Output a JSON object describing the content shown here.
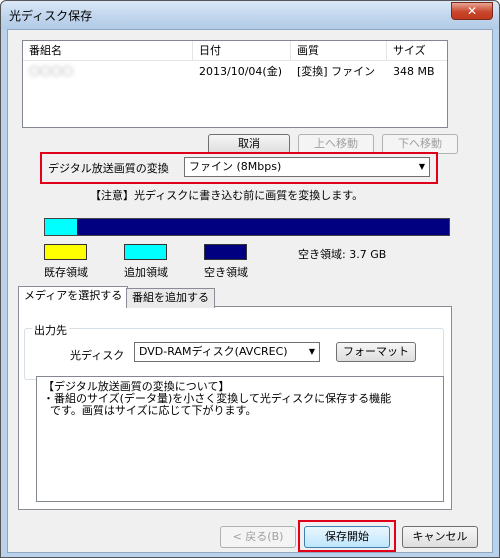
{
  "window": {
    "title": "光ディスク保存",
    "close_glyph": "✕"
  },
  "list": {
    "columns": [
      "番組名",
      "日付",
      "画質",
      "サイズ"
    ],
    "rows": [
      {
        "name": "〇〇〇〇",
        "date": "2013/10/04(金)",
        "quality": "[変換] ファイン",
        "size": "348 MB"
      }
    ]
  },
  "list_buttons": {
    "cancel": "取消",
    "up": "上へ移動",
    "down": "下へ移動"
  },
  "conversion": {
    "label": "デジタル放送画質の変換",
    "selected": "ファイン (8Mbps)",
    "note": "【注意】光ディスクに書き込む前に画質を変換します。"
  },
  "capacity": {
    "existing_fraction": 0.0,
    "added_fraction": 0.08,
    "free_text": "空き領域:  3.7 GB",
    "legend": {
      "existing": "既存領域",
      "added": "追加領域",
      "free": "空き領域"
    },
    "colors": {
      "existing": "#ffff00",
      "added": "#00ffff",
      "free": "#000080"
    }
  },
  "tabs": {
    "select_media": "メディアを選択する",
    "add_program": "番組を追加する"
  },
  "output": {
    "group_label": "出力先",
    "disc_label": "光ディスク",
    "disc_selected": "DVD-RAMディスク(AVCREC)",
    "format_button": "フォーマット"
  },
  "description": "【デジタル放送画質の変換について】\n・番組のサイズ(データ量)を小さく変換して光ディスクに保存する機能\n  です。画質はサイズに応じて下がります。",
  "footer": {
    "back": "< 戻る(B)",
    "start": "保存開始",
    "cancel": "キャンセル"
  },
  "accent": {
    "highlight": "#e0001a",
    "titlebar": "#c3d7ee"
  }
}
